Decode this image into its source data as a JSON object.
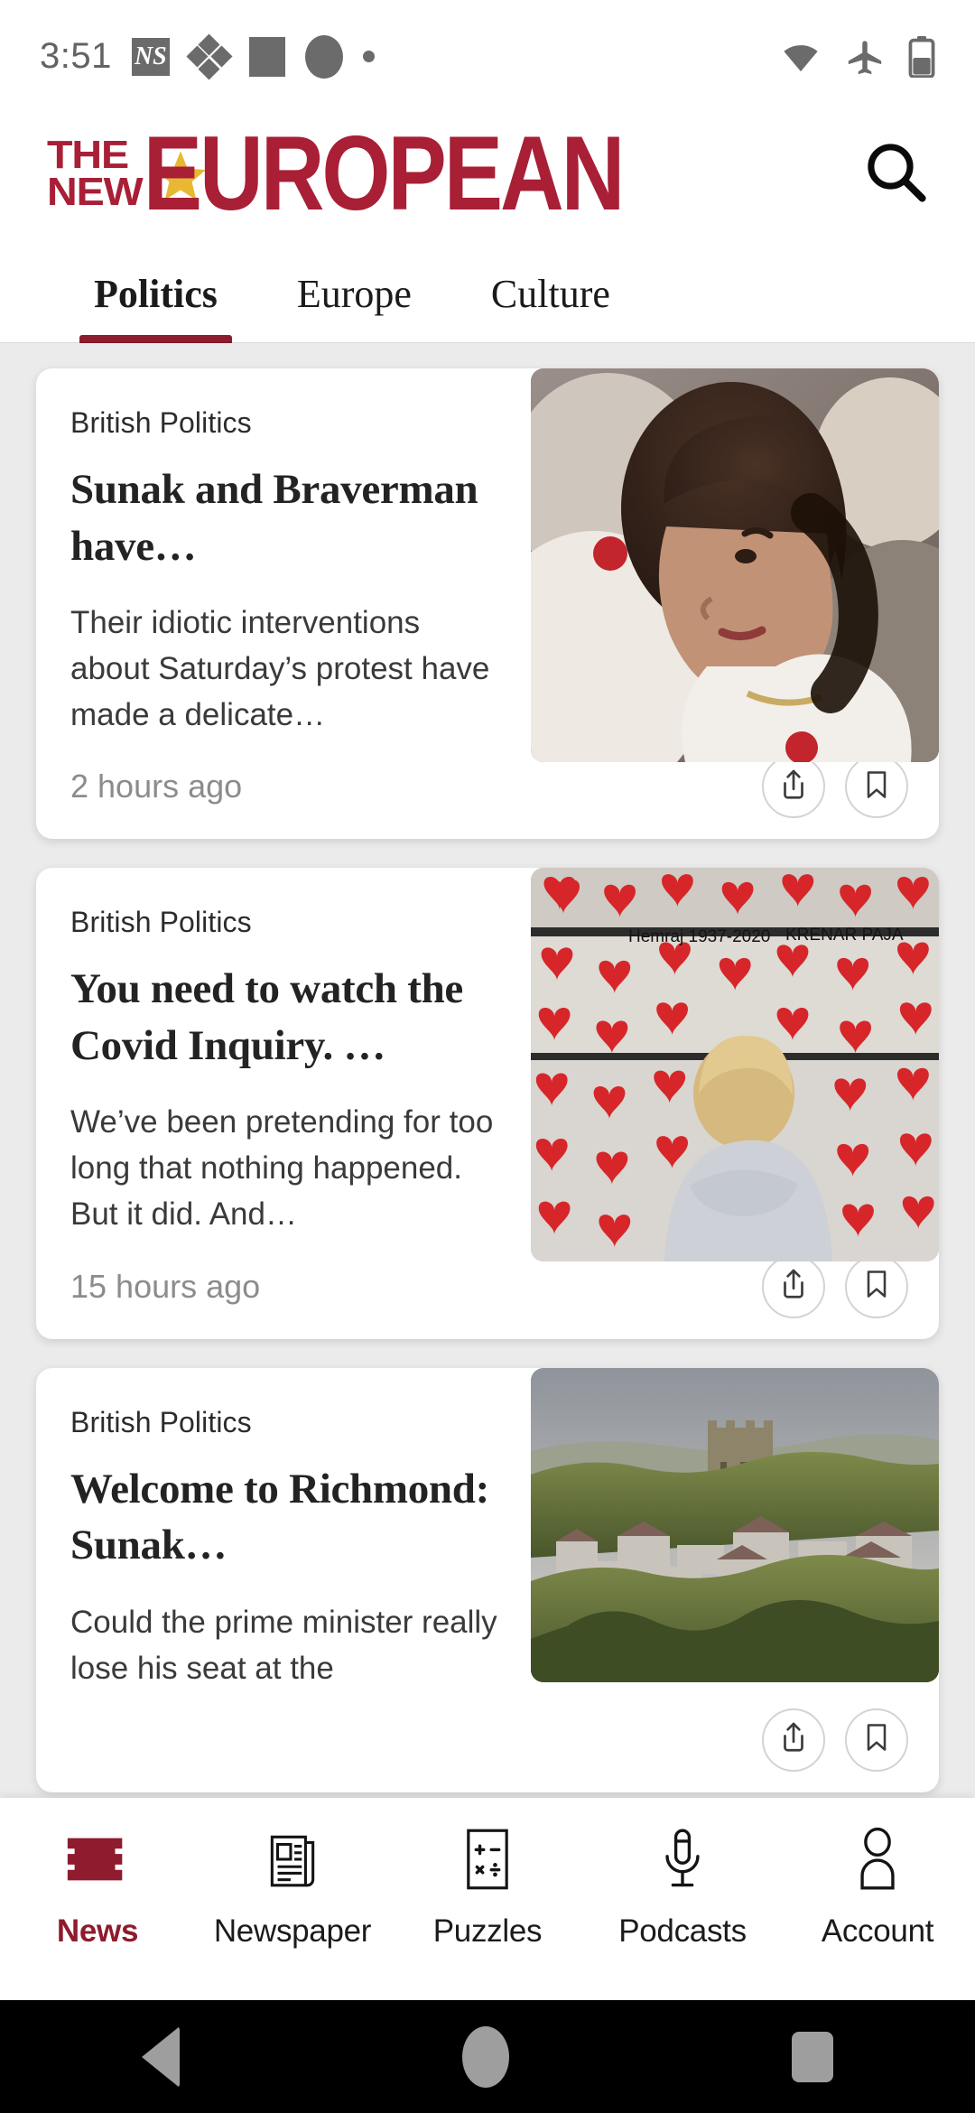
{
  "status_bar": {
    "time": "3:51",
    "left_icons": [
      "ns-app-icon",
      "diamond-icon",
      "square-icon",
      "circle-icon",
      "dot-icon"
    ],
    "right_icons": [
      "wifi-icon",
      "airplane-mode-icon",
      "battery-icon"
    ],
    "ns_badge_text": "NS"
  },
  "masthead": {
    "logo_line1": "THE",
    "logo_line2": "NEW",
    "logo_main": "EUROPEAN",
    "search_icon": "search-icon",
    "brand_color": "#a81f36",
    "star_color": "#e8b832"
  },
  "tabs": {
    "items": [
      {
        "label": "Politics",
        "active": true
      },
      {
        "label": "Europe",
        "active": false
      },
      {
        "label": "Culture",
        "active": false
      }
    ],
    "active_color": "#8e1b2e"
  },
  "feed": {
    "articles": [
      {
        "category": "British Politics",
        "headline": "Sunak and Braverman have…",
        "excerpt": "Their idiotic interventions about Saturday’s protest have made a delicate…",
        "timestamp": "2 hours ago",
        "image": "portrait-woman-in-white-jacket",
        "share_icon": "share-icon",
        "bookmark_icon": "bookmark-icon"
      },
      {
        "category": "British Politics",
        "headline": "You need to watch the Covid Inquiry. …",
        "excerpt": "We’ve been pretending for too long that nothing happened. But it did. And…",
        "timestamp": "15 hours ago",
        "image": "covid-memorial-wall-red-hearts",
        "share_icon": "share-icon",
        "bookmark_icon": "bookmark-icon"
      },
      {
        "category": "British Politics",
        "headline": "Welcome to Richmond: Sunak…",
        "excerpt": "Could the prime minister really lose his seat at the",
        "timestamp": "",
        "image": "richmond-castle-town-landscape",
        "share_icon": "share-icon",
        "bookmark_icon": "bookmark-icon"
      }
    ]
  },
  "bottom_nav": {
    "items": [
      {
        "label": "News",
        "icon": "news-lines-icon",
        "active": true
      },
      {
        "label": "Newspaper",
        "icon": "newspaper-icon",
        "active": false
      },
      {
        "label": "Puzzles",
        "icon": "puzzles-calculator-icon",
        "active": false
      },
      {
        "label": "Podcasts",
        "icon": "microphone-icon",
        "active": false
      },
      {
        "label": "Account",
        "icon": "person-icon",
        "active": false
      }
    ],
    "active_color": "#8e1b2e"
  },
  "system_nav": {
    "back": "back-triangle-icon",
    "home": "home-circle-icon",
    "recents": "recents-square-icon"
  }
}
